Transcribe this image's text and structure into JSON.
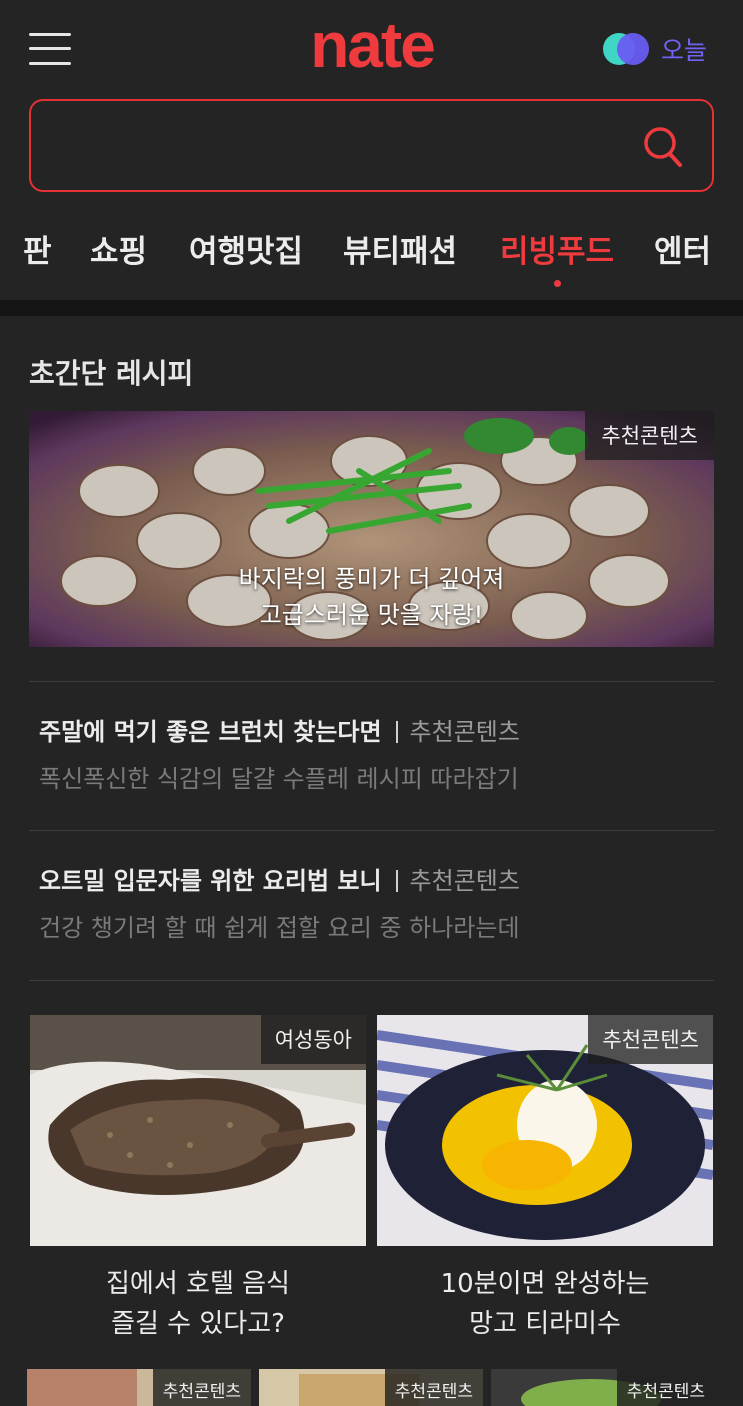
{
  "header": {
    "logo_text": "nate",
    "brand_color": "#ef3b3e",
    "theme_toggle_label": "오늘",
    "search": {
      "placeholder": "",
      "value": ""
    }
  },
  "tabs": [
    {
      "label": "판",
      "active": false
    },
    {
      "label": "쇼핑",
      "active": false
    },
    {
      "label": "여행맛집",
      "active": false
    },
    {
      "label": "뷰티패션",
      "active": false
    },
    {
      "label": "리빙푸드",
      "active": true
    },
    {
      "label": "엔터",
      "active": false
    }
  ],
  "section": {
    "title": "초간단 레시피",
    "hero": {
      "badge": "추천콘텐츠",
      "caption_line1": "바지락의 풍미가 더 깊어져",
      "caption_line2": "고급스러운 맛을 자랑!"
    },
    "articles": [
      {
        "title": "주말에 먹기 좋은 브런치 찾는다면",
        "source": "추천콘텐츠",
        "summary": "폭신폭신한 식감의 달걀 수플레 레시피 따라잡기"
      },
      {
        "title": "오트밀 입문자를 위한 요리법 보니",
        "source": "추천콘텐츠",
        "summary": "건강 챙기려 할 때 쉽게 접할 요리 중 하나라는데"
      }
    ],
    "cards": [
      {
        "badge": "여성동아",
        "title_line1": "집에서 호텔 음식",
        "title_line2": "즐길 수 있다고?"
      },
      {
        "badge": "추천콘텐츠",
        "title_line1": "10분이면 완성하는",
        "title_line2": "망고 티라미수"
      }
    ],
    "mini_cards": [
      {
        "badge": "추천콘텐츠"
      },
      {
        "badge": "추천콘텐츠"
      },
      {
        "badge": "추천콘텐츠"
      }
    ]
  }
}
